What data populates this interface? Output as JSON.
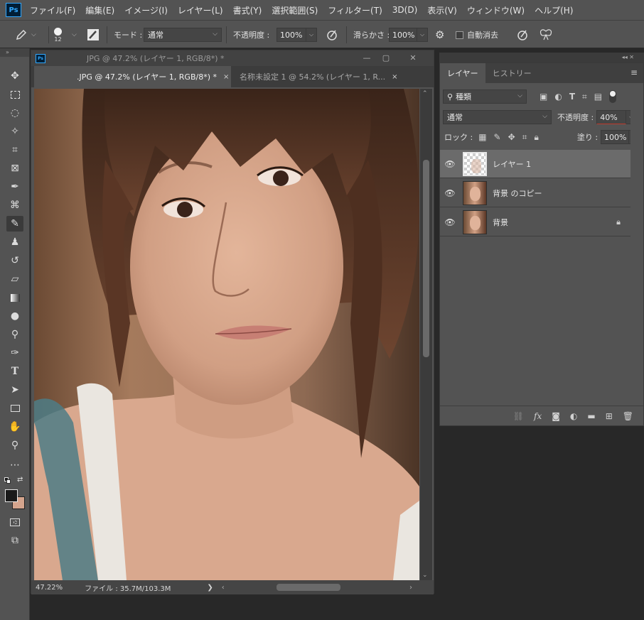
{
  "app": {
    "logo": "Ps"
  },
  "menu": [
    "ファイル(F)",
    "編集(E)",
    "イメージ(I)",
    "レイヤー(L)",
    "書式(Y)",
    "選択範囲(S)",
    "フィルター(T)",
    "3D(D)",
    "表示(V)",
    "ウィンドウ(W)",
    "ヘルプ(H)"
  ],
  "options": {
    "brush_size": "12",
    "mode_label": "モード :",
    "mode_value": "通常",
    "opacity_label": "不透明度 :",
    "opacity_value": "100%",
    "smoothing_label": "滑らかさ :",
    "smoothing_value": "100%",
    "auto_erase_label": "自動消去"
  },
  "document": {
    "window_title": "JPG @ 47.2% (レイヤー 1, RGB/8*) *",
    "tabs": [
      {
        "label": ".JPG @ 47.2% (レイヤー 1, RGB/8*) *",
        "close": "×"
      },
      {
        "label": "名称未設定 1 @ 54.2% (レイヤー 1, R...",
        "close": "×"
      }
    ],
    "zoom": "47.22%",
    "file_info": "ファイル : 35.7M/103.3M",
    "status_arrow": "❯"
  },
  "layers_panel": {
    "tabs": [
      "レイヤー",
      "ヒストリー"
    ],
    "filter_label": "種類",
    "blend_mode": "通常",
    "opacity_label": "不透明度 :",
    "opacity_value": "40%",
    "lock_label": "ロック :",
    "fill_label": "塗り :",
    "fill_value": "100%",
    "layers": [
      {
        "name": "レイヤー 1",
        "selected": true
      },
      {
        "name": "背景 のコピー",
        "selected": false
      },
      {
        "name": "背景",
        "selected": false,
        "locked": true
      }
    ],
    "bottom_icons": [
      "link-icon",
      "fx-icon",
      "mask-icon",
      "adjustment-icon",
      "folder-icon",
      "new-layer-icon",
      "trash-icon"
    ],
    "fx_label": "fx"
  },
  "colors": {
    "accent": "#31a8ff",
    "panel": "#535353",
    "dark": "#282828"
  }
}
